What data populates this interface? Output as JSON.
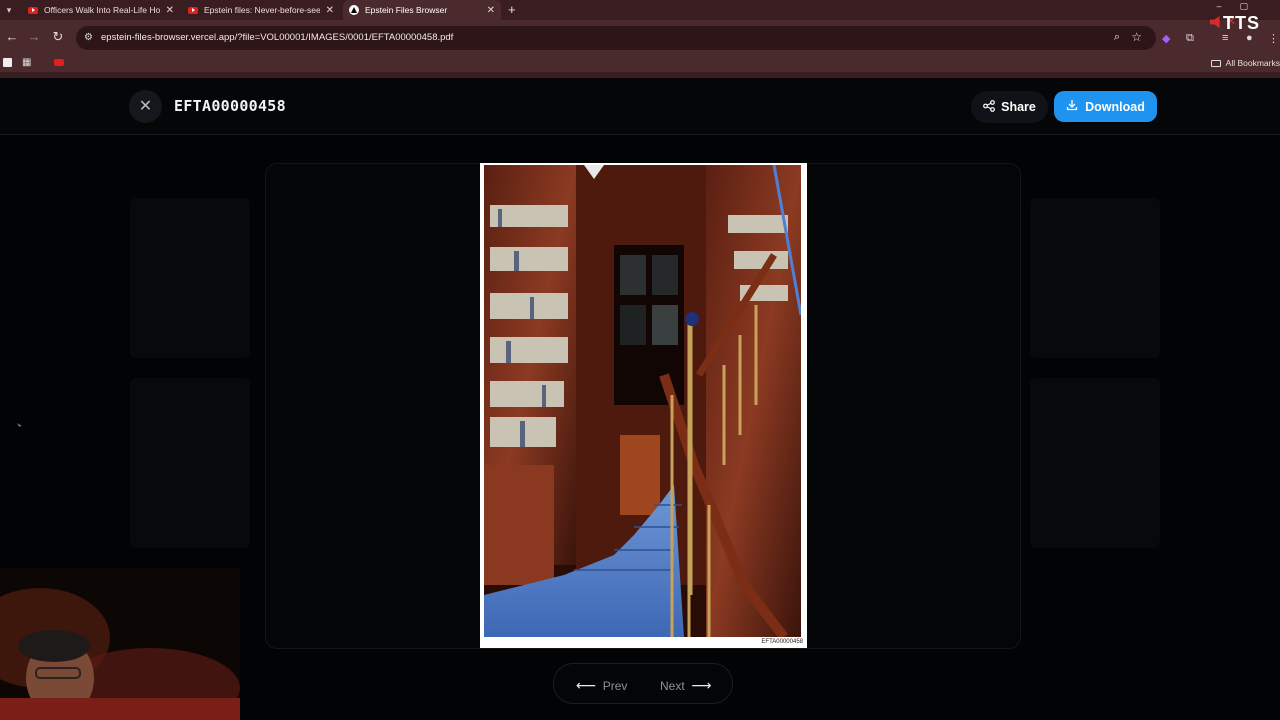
{
  "browser": {
    "tabs": [
      {
        "title": "Officers Walk Into Real-Life Ho",
        "favicon": "youtube-icon",
        "active": false
      },
      {
        "title": "Epstein files: Never-before-see",
        "favicon": "youtube-icon",
        "active": false
      },
      {
        "title": "Epstein Files Browser",
        "favicon": "vercel-icon",
        "active": true
      }
    ],
    "url": "epstein-files-browser.vercel.app/?file=VOL00001/IMAGES/0001/EFTA00000458.pdf",
    "bookmarks_all_label": "All Bookmarks",
    "overlay_badge": "TTS"
  },
  "app": {
    "document_title": "EFTA00000458",
    "share_label": "Share",
    "download_label": "Download",
    "page_stamp": "EFTA00000458",
    "prev_label": "Prev",
    "next_label": "Next",
    "accent_color": "#1e93ef"
  }
}
